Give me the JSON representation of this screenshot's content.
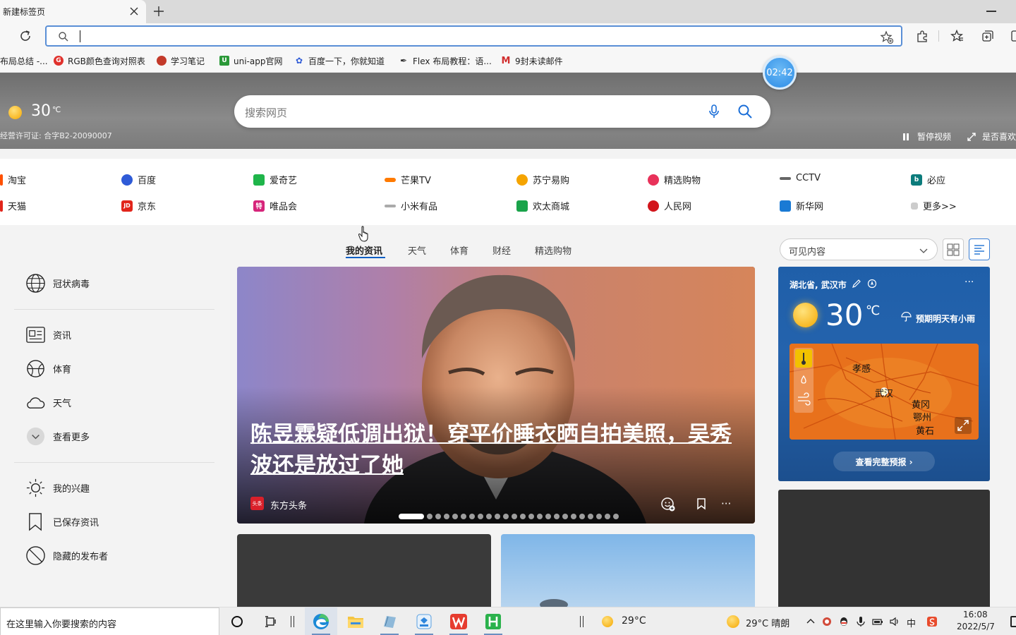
{
  "browser": {
    "tab_title": "新建标签页",
    "new_tab_symbol": "+",
    "address_value": "",
    "bookmarks": [
      {
        "label": "布局总结 -...",
        "icon": "page-icon",
        "color": "#888888"
      },
      {
        "label": "RGB颜色查询对照表",
        "icon": "g-icon",
        "color": "#e0322d"
      },
      {
        "label": "学习笔记",
        "icon": "ladybug-icon",
        "color": "#c33a2a"
      },
      {
        "label": "uni-app官网",
        "icon": "u-icon",
        "color": "#2b9939"
      },
      {
        "label": "百度一下，你就知道",
        "icon": "paw-icon",
        "color": "#2f5bd7"
      },
      {
        "label": "Flex 布局教程：语...",
        "icon": "feather-icon",
        "color": "#333333"
      },
      {
        "label": "9封未读邮件",
        "icon": "m-icon",
        "color": "#d12e2e"
      }
    ],
    "timer": "02:42"
  },
  "hero": {
    "temp": "30",
    "temp_unit": "℃",
    "license": "经营许可证: 合字B2-20090007",
    "search_placeholder": "搜索网页",
    "pause_label": "暂停视频",
    "like_label": "是否喜欢"
  },
  "quick_links": [
    [
      {
        "label": "淘宝",
        "color": "#ff5000",
        "glyph": ""
      },
      {
        "label": "百度",
        "color": "#2f5bd7",
        "glyph": ""
      },
      {
        "label": "爱奇艺",
        "color": "#1fb54a",
        "glyph": ""
      },
      {
        "label": "芒果TV",
        "color": "#ff7a00",
        "glyph": ""
      },
      {
        "label": "苏宁易购",
        "color": "#f5a400",
        "glyph": ""
      },
      {
        "label": "精选购物",
        "color": "#e8325a",
        "glyph": ""
      },
      {
        "label": "CCTV",
        "color": "#666666",
        "glyph": ""
      },
      {
        "label": "必应",
        "color": "#0c7c7c",
        "glyph": "b"
      }
    ],
    [
      {
        "label": "天猫",
        "color": "#e1251b",
        "glyph": ""
      },
      {
        "label": "京东",
        "color": "#e1251b",
        "glyph": "JD"
      },
      {
        "label": "唯品会",
        "color": "#d6247a",
        "glyph": "特"
      },
      {
        "label": "小米有品",
        "color": "#888888",
        "glyph": ""
      },
      {
        "label": "欢太商城",
        "color": "#1aa34a",
        "glyph": ""
      },
      {
        "label": "人民网",
        "color": "#d2151c",
        "glyph": ""
      },
      {
        "label": "新华网",
        "color": "#1a7ad4",
        "glyph": ""
      },
      {
        "label": "更多>>",
        "color": "#bbbbbb",
        "glyph": ""
      }
    ]
  ],
  "feed_tabs": [
    "我的资讯",
    "天气",
    "体育",
    "财经",
    "精选购物"
  ],
  "content_select": "可见内容",
  "sidebar": {
    "covid": "冠状病毒",
    "items": [
      "资讯",
      "体育",
      "天气",
      "查看更多"
    ],
    "personal": [
      "我的兴趣",
      "已保存资讯",
      "隐藏的发布者"
    ]
  },
  "main_card": {
    "title": "陈昱霖疑低调出狱！穿平价睡衣晒自拍美照，吴秀波还是放过了她",
    "source": "东方头条",
    "source_logo_text": "头条",
    "more_symbol": "···",
    "total_slides": 24,
    "active_slide": 1
  },
  "weather_card": {
    "location": "湖北省, 武汉市",
    "temp": "30",
    "unit": "℃",
    "forecast": "预期明天有小雨",
    "map_labels": [
      "孝感",
      "武汉",
      "黄冈",
      "鄂州",
      "黄石"
    ],
    "button": "查看完整预报 ›",
    "more_symbol": "···"
  },
  "taskbar": {
    "search_text": "在这里输入你要搜索的内容",
    "weather_temp": "29°C",
    "tray_weather": "29°C  晴朗",
    "time": "16:08",
    "date": "2022/5/7",
    "ime": "中"
  }
}
